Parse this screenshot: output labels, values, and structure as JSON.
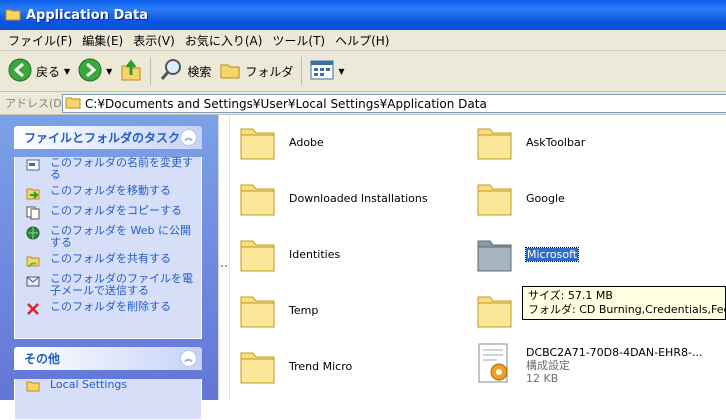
{
  "window": {
    "title": "Application Data"
  },
  "menu": [
    "ファイル(F)",
    "編集(E)",
    "表示(V)",
    "お気に入り(A)",
    "ツール(T)",
    "ヘルプ(H)"
  ],
  "toolbar": {
    "back_label": "戻る",
    "search_label": "検索",
    "folders_label": "フォルダ"
  },
  "address": {
    "label": "アドレス(D)",
    "value": "C:¥Documents and Settings¥User¥Local Settings¥Application Data"
  },
  "tasks_panel": {
    "title": "ファイルとフォルダのタスク",
    "items": [
      "このフォルダの名前を変更する",
      "このフォルダを移動する",
      "このフォルダをコピーする",
      "このフォルダを Web に公開する",
      "このフォルダを共有する",
      "このフォルダのファイルを電子メールで送信する",
      "このフォルダを削除する"
    ]
  },
  "other_panel": {
    "title": "その他",
    "items": [
      "Local Settings"
    ]
  },
  "files": {
    "adobe": "Adobe",
    "asktoolbar": "AskToolbar",
    "downloaded": "Downloaded Installations",
    "google": "Google",
    "identities": "Identities",
    "microsoft": "Microsoft",
    "temp": "Temp",
    "trendmicro": "Trend Micro",
    "config_file": {
      "name": "DCBC2A71-70D8-4DAN-EHR8-...",
      "type": "構成設定",
      "size": "12 KB"
    }
  },
  "tooltip": {
    "size_line": "サイズ: 57.1 MB",
    "folders_line": "フォルダ: CD Burning,Credentials,Feeds,I"
  },
  "colors": {
    "title_blue": "#0a5de8",
    "task_blue": "#215dc6",
    "selection": "#316ac5"
  }
}
